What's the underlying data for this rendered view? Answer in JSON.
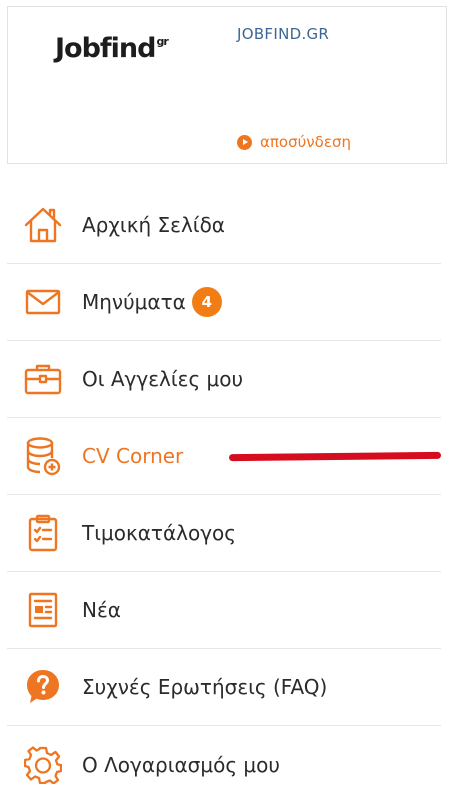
{
  "header": {
    "logo_text": "Jobfind",
    "logo_mark": "gr",
    "account_name": "JOBFIND.GR",
    "logout_label": "αποσύνδεση"
  },
  "colors": {
    "accent": "#ee7622",
    "badge": "#f27d14",
    "link_blue": "#3c6795",
    "annotation_red": "#d60d1f"
  },
  "menu": {
    "items": [
      {
        "label": "Αρχική Σελίδα",
        "icon": "home-icon"
      },
      {
        "label": "Μηνύματα",
        "icon": "envelope-icon",
        "badge": "4"
      },
      {
        "label": "Οι Αγγελίες μου",
        "icon": "briefcase-icon"
      },
      {
        "label": "CV Corner",
        "icon": "database-add-icon",
        "active": true
      },
      {
        "label": "Τιμοκατάλογος",
        "icon": "clipboard-list-icon"
      },
      {
        "label": "Νέα",
        "icon": "newspaper-icon"
      },
      {
        "label": "Συχνές Ερωτήσεις (FAQ)",
        "icon": "question-circle-icon"
      },
      {
        "label": "Ο Λογαριασμός μου",
        "icon": "gear-icon"
      }
    ]
  }
}
